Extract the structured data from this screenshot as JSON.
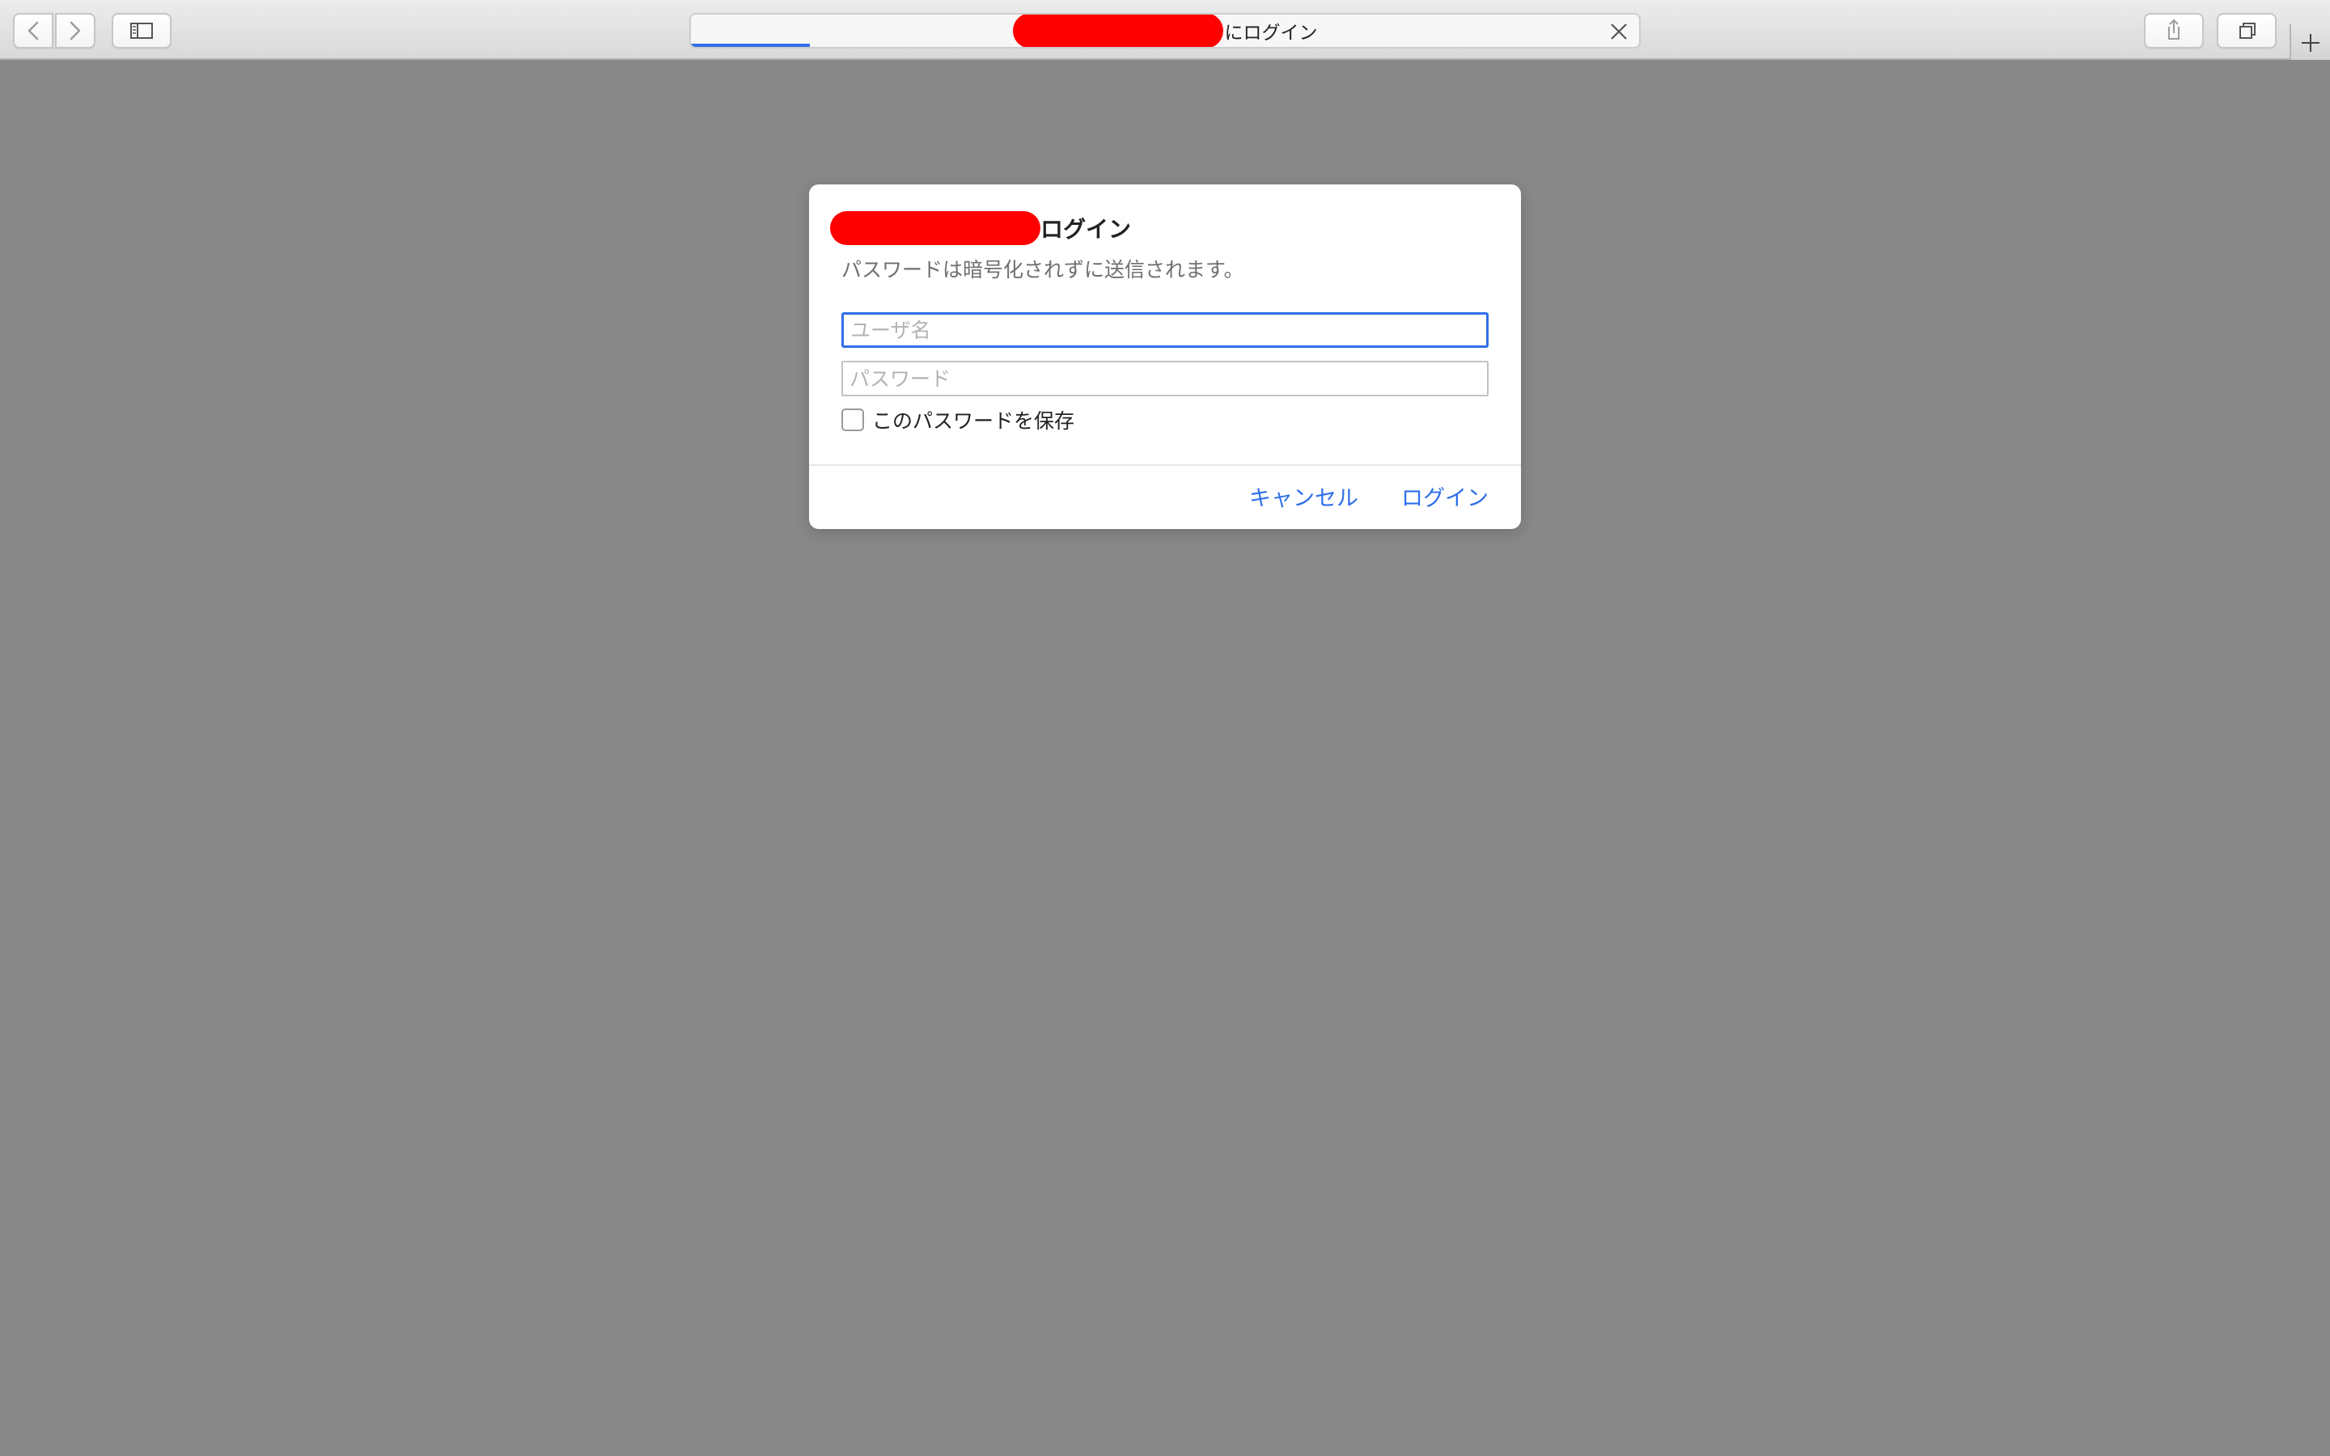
{
  "browser": {
    "tab_title": "にログイン",
    "load_progress_percent": 12.5,
    "icons": {
      "back": "chevron-left-icon",
      "forward": "chevron-right-icon",
      "sidebar": "sidebar-icon",
      "stop": "close-icon",
      "share": "share-icon",
      "tabs": "tab-overview-icon",
      "new_tab": "plus-icon"
    }
  },
  "dialog": {
    "title": "ログイン",
    "subtitle": "パスワードは暗号化されずに送信されます。",
    "username": {
      "placeholder": "ユーザ名",
      "value": ""
    },
    "password": {
      "placeholder": "パスワード",
      "value": ""
    },
    "save_password_label": "このパスワードを保存",
    "save_password_checked": false,
    "cancel_label": "キャンセル",
    "login_label": "ログイン"
  },
  "colors": {
    "accent": "#2f6fe8",
    "redaction": "#ff0000",
    "backdrop": "#888888"
  }
}
